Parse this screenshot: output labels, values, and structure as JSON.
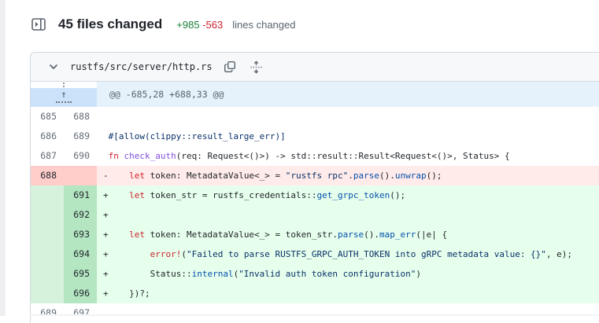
{
  "page": {
    "summary": {
      "title": "45 files changed",
      "additions": "+985",
      "deletions": "-563",
      "suffix": "lines changed"
    },
    "file_header": {
      "path": "rustfs/src/server/http.rs"
    },
    "hunk": {
      "header": "@@ -685,28 +688,33 @@"
    },
    "colors": {
      "addition_text": "#1a7f37",
      "deletion_text": "#cf222e",
      "addition_code_bg": "#e6ffec",
      "addition_num_bg": "#b3e6c1",
      "deletion_code_bg": "#ffebe9",
      "deletion_num_bg": "#ffcecb",
      "hunk_gutter_bg": "#cbe3fa",
      "hunk_text_bg": "#e5f2fc",
      "keyword": "#cf222e",
      "function_name": "#8250df",
      "method_call": "#0550ae",
      "string": "#0a3069"
    },
    "diff": {
      "rows": [
        {
          "type": "context",
          "old": "685",
          "new": "688",
          "marker": " ",
          "code": []
        },
        {
          "type": "context",
          "old": "686",
          "new": "689",
          "marker": " ",
          "code": [
            [
              "attr",
              "#[allow(clippy::result_large_err)]"
            ]
          ]
        },
        {
          "type": "context",
          "old": "687",
          "new": "690",
          "marker": " ",
          "code": [
            [
              "kw",
              "fn"
            ],
            [
              "plain",
              " "
            ],
            [
              "func",
              "check_auth"
            ],
            [
              "plain",
              "(req: Request<()>) -> std::result::Result<Request<()>, Status> {"
            ]
          ]
        },
        {
          "type": "del",
          "old": "688",
          "new": "",
          "marker": "-",
          "code": [
            [
              "plain",
              "    "
            ],
            [
              "kw",
              "let"
            ],
            [
              "plain",
              " token: MetadataValue<_> = "
            ],
            [
              "str",
              "\"rustfs rpc\""
            ],
            [
              "plain",
              "."
            ],
            [
              "call",
              "parse"
            ],
            [
              "plain",
              "()."
            ],
            [
              "call",
              "unwrap"
            ],
            [
              "plain",
              "();"
            ]
          ]
        },
        {
          "type": "add",
          "old": "",
          "new": "691",
          "marker": "+",
          "code": [
            [
              "plain",
              "    "
            ],
            [
              "kw",
              "let"
            ],
            [
              "plain",
              " token_str = rustfs_credentials::"
            ],
            [
              "call",
              "get_grpc_token"
            ],
            [
              "plain",
              "();"
            ]
          ]
        },
        {
          "type": "add",
          "old": "",
          "new": "692",
          "marker": "+",
          "code": []
        },
        {
          "type": "add",
          "old": "",
          "new": "693",
          "marker": "+",
          "code": [
            [
              "plain",
              "    "
            ],
            [
              "kw",
              "let"
            ],
            [
              "plain",
              " token: MetadataValue<_> = token_str."
            ],
            [
              "call",
              "parse"
            ],
            [
              "plain",
              "()."
            ],
            [
              "call",
              "map_err"
            ],
            [
              "plain",
              "(|e| {"
            ]
          ]
        },
        {
          "type": "add",
          "old": "",
          "new": "694",
          "marker": "+",
          "code": [
            [
              "plain",
              "        "
            ],
            [
              "kw",
              "error!"
            ],
            [
              "plain",
              "("
            ],
            [
              "str",
              "\"Failed to parse RUSTFS_GRPC_AUTH_TOKEN into gRPC metadata value: {}\""
            ],
            [
              "plain",
              ", e);"
            ]
          ]
        },
        {
          "type": "add",
          "old": "",
          "new": "695",
          "marker": "+",
          "code": [
            [
              "plain",
              "        Status::"
            ],
            [
              "call",
              "internal"
            ],
            [
              "plain",
              "("
            ],
            [
              "str",
              "\"Invalid auth token configuration\""
            ],
            [
              "plain",
              ")"
            ]
          ]
        },
        {
          "type": "add",
          "old": "",
          "new": "696",
          "marker": "+",
          "code": [
            [
              "plain",
              "    })?;"
            ]
          ]
        },
        {
          "type": "context",
          "old": "689",
          "new": "697",
          "marker": " ",
          "code": []
        }
      ]
    }
  }
}
